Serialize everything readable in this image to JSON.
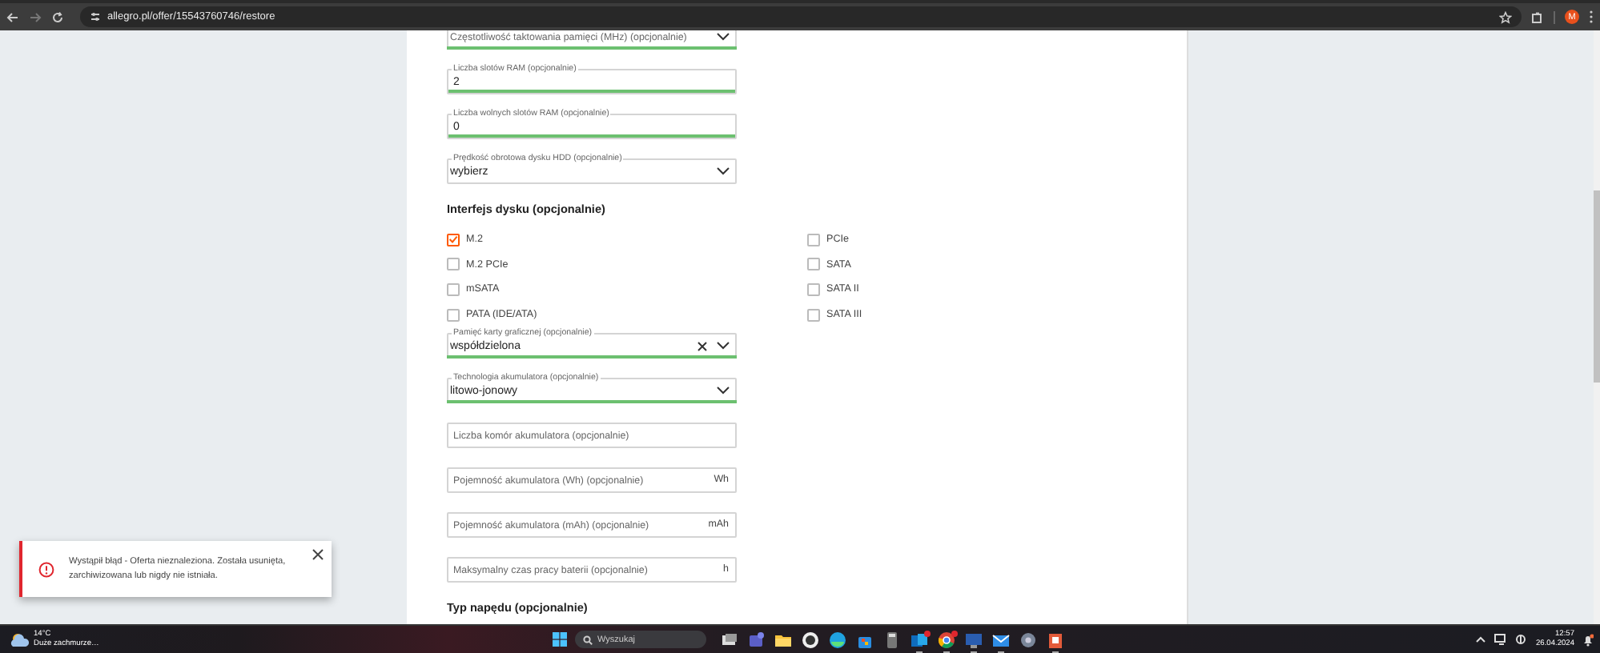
{
  "browser": {
    "url": "allegro.pl/offer/15543760746/restore",
    "profile_initial": "M"
  },
  "form": [
    {
      "kind": "select",
      "placeholder": "Częstotliwość taktowania pamięci (MHz) (opcjonalnie)",
      "valid": true
    },
    {
      "kind": "input",
      "label": "Liczba slotów RAM (opcjonalnie)",
      "value": "2",
      "valid": true
    },
    {
      "kind": "input",
      "label": "Liczba wolnych slotów RAM (opcjonalnie)",
      "value": "0",
      "valid": true
    },
    {
      "kind": "select",
      "label": "Prędkość obrotowa dysku HDD (opcjonalnie)",
      "value": "wybierz",
      "valid": false
    },
    {
      "kind": "heading",
      "text": "Interfejs dysku (opcjonalnie)"
    },
    {
      "kind": "checkgroup",
      "options": [
        {
          "label": "M.2",
          "checked": true
        },
        {
          "label": "M.2 PCIe",
          "checked": false
        },
        {
          "label": "mSATA",
          "checked": false
        },
        {
          "label": "PATA (IDE/ATA)",
          "checked": false
        },
        {
          "label": "PCIe",
          "checked": false
        },
        {
          "label": "SATA",
          "checked": false
        },
        {
          "label": "SATA II",
          "checked": false
        },
        {
          "label": "SATA III",
          "checked": false
        }
      ]
    },
    {
      "kind": "select",
      "label": "Pamięć karty graficznej (opcjonalnie)",
      "value": "współdzielona",
      "valid": true,
      "clearable": true
    },
    {
      "kind": "select",
      "label": "Technologia akumulatora (opcjonalnie)",
      "value": "litowo-jonowy",
      "valid": true
    },
    {
      "kind": "input",
      "placeholder": "Liczba komór akumulatora (opcjonalnie)",
      "valid": false
    },
    {
      "kind": "input",
      "placeholder": "Pojemność akumulatora (Wh) (opcjonalnie)",
      "unit": "Wh",
      "valid": false
    },
    {
      "kind": "input",
      "placeholder": "Pojemność akumulatora (mAh) (opcjonalnie)",
      "unit": "mAh",
      "valid": false
    },
    {
      "kind": "input",
      "placeholder": "Maksymalny czas pracy baterii (opcjonalnie)",
      "unit": "h",
      "valid": false
    },
    {
      "kind": "heading",
      "text": "Typ napędu (opcjonalnie)"
    }
  ],
  "toast": {
    "message": "Wystąpił błąd - Oferta nieznaleziona. Została usunięta, zarchiwizowana lub nigdy nie istniała."
  },
  "taskbar": {
    "weather": {
      "temp": "14°C",
      "text": "Duże zachmurze…"
    },
    "search": {
      "placeholder": "Wyszukaj"
    },
    "apps": [
      {
        "kind": "taskview",
        "running": false,
        "badge": false
      },
      {
        "kind": "chat",
        "running": false,
        "badge": false
      },
      {
        "kind": "folder",
        "running": false,
        "badge": false
      },
      {
        "kind": "circle",
        "running": false,
        "badge": false
      },
      {
        "kind": "globe",
        "running": false,
        "badge": false
      },
      {
        "kind": "bag",
        "running": false,
        "badge": false
      },
      {
        "kind": "calculator",
        "running": false,
        "badge": false
      },
      {
        "kind": "mail",
        "running": true,
        "badge": true
      },
      {
        "kind": "browser",
        "running": true,
        "badge": true
      },
      {
        "kind": "monitor",
        "running": true,
        "badge": false
      },
      {
        "kind": "envelope",
        "running": true,
        "badge": false
      },
      {
        "kind": "gear",
        "running": false,
        "badge": false
      },
      {
        "kind": "photo",
        "running": true,
        "badge": false
      }
    ],
    "time": "12:57",
    "date": "26.04.2024"
  }
}
